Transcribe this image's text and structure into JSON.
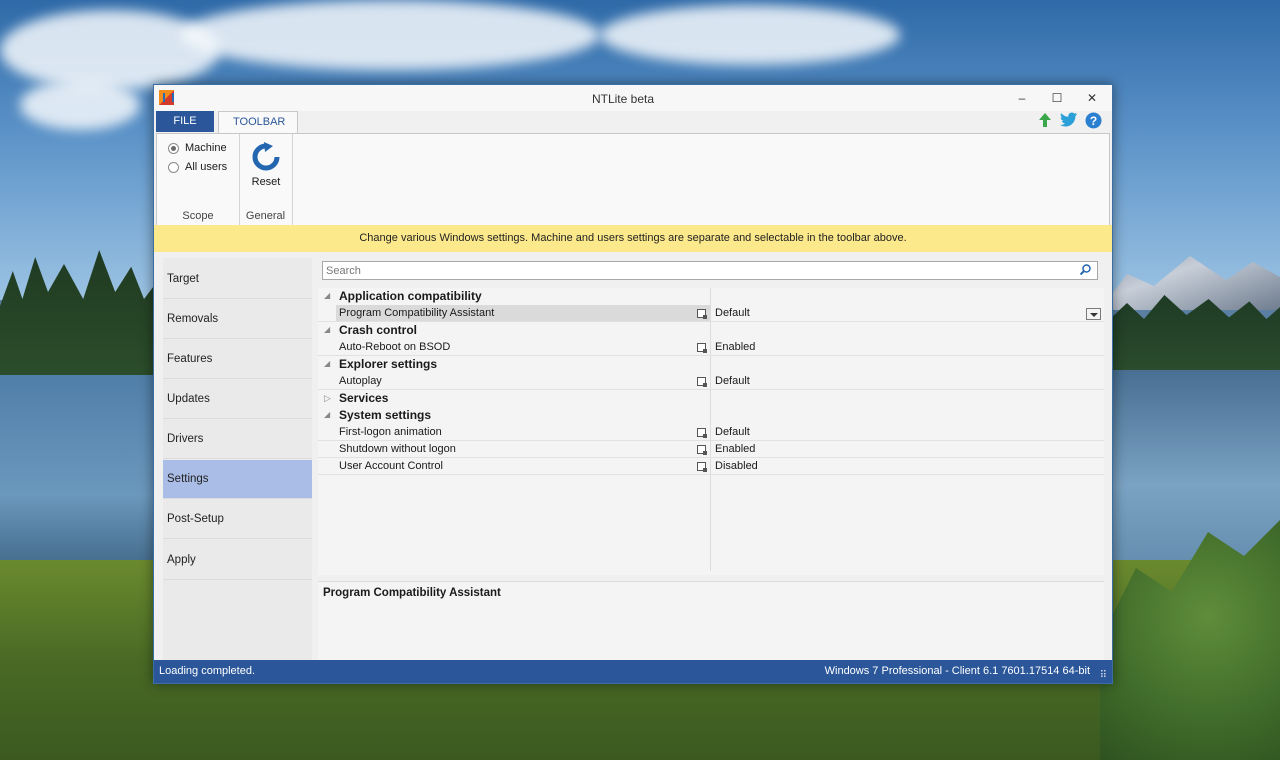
{
  "window": {
    "title": "NTLite beta"
  },
  "window_controls": {
    "minimize": "–",
    "maximize": "☐",
    "close": "✕"
  },
  "tabs": {
    "file": "FILE",
    "toolbar": "TOOLBAR"
  },
  "top_icons": {
    "update": "update-arrow-icon",
    "twitter": "twitter-icon",
    "help": "help-icon"
  },
  "ribbon": {
    "scope": {
      "label": "Scope",
      "options": [
        "Machine",
        "All users"
      ],
      "selected": "Machine"
    },
    "general": {
      "label": "General",
      "reset_label": "Reset"
    }
  },
  "infobar": {
    "text": "Change various Windows settings. Machine and users settings are separate and selectable in the toolbar above."
  },
  "sidebar": {
    "items": [
      "Target",
      "Removals",
      "Features",
      "Updates",
      "Drivers",
      "Settings",
      "Post-Setup",
      "Apply"
    ],
    "active": "Settings"
  },
  "search": {
    "placeholder": "Search"
  },
  "tree": {
    "categories": {
      "app_compat": "Application compatibility",
      "crash": "Crash control",
      "explorer": "Explorer settings",
      "services": "Services",
      "system": "System settings"
    },
    "items": {
      "pca": {
        "name": "Program Compatibility Assistant",
        "value": "Default"
      },
      "autoreboot": {
        "name": "Auto-Reboot on BSOD",
        "value": "Enabled"
      },
      "autoplay": {
        "name": "Autoplay",
        "value": "Default"
      },
      "firstlogon": {
        "name": "First-logon animation",
        "value": "Default"
      },
      "shutdown": {
        "name": "Shutdown without logon",
        "value": "Enabled"
      },
      "uac": {
        "name": "User Account Control",
        "value": "Disabled"
      }
    }
  },
  "description": {
    "title": "Program Compatibility Assistant"
  },
  "status": {
    "left": "Loading completed.",
    "right": "Windows 7 Professional - Client 6.1 7601.17514 64-bit"
  },
  "colors": {
    "accent": "#2b579a",
    "infobar": "#fce98c",
    "nav_active": "#a9bde6"
  }
}
